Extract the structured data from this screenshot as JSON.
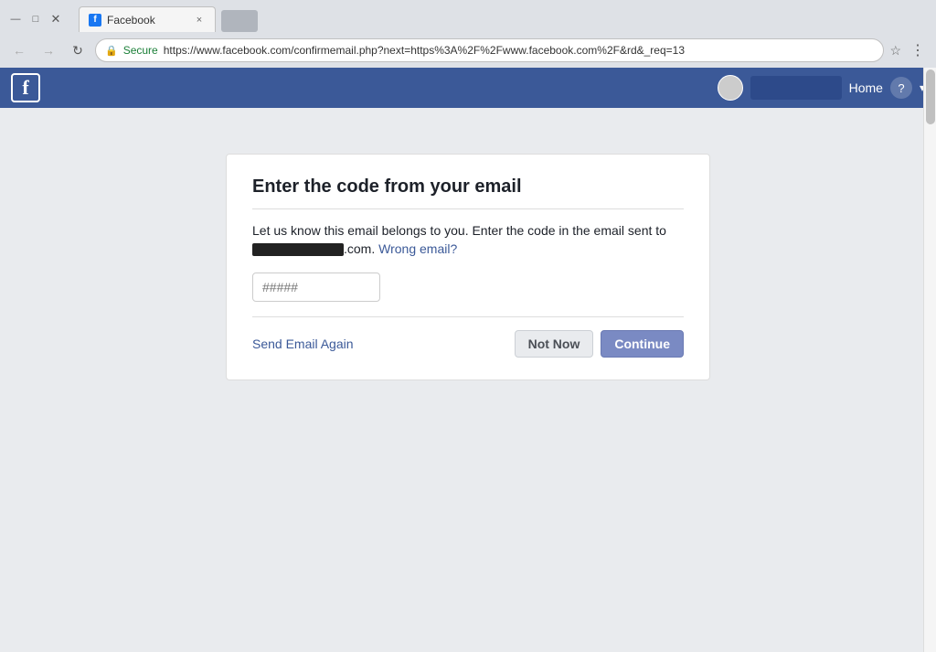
{
  "browser": {
    "title_bar": {
      "minimize_label": "—",
      "maximize_label": "□",
      "close_label": "✕"
    },
    "tab": {
      "favicon_letter": "f",
      "title": "Facebook",
      "close_label": "×"
    },
    "address_bar": {
      "secure_label": "Secure",
      "url": "https://www.facebook.com/confirmemail.php?next=https%3A%2F%2Fwww.facebook.com%2F&rd&_req=13",
      "lock_icon": "🔒",
      "star_icon": "☆"
    },
    "nav": {
      "back_icon": "←",
      "forward_icon": "→",
      "reload_icon": "↻",
      "menu_icon": "⋮"
    }
  },
  "facebook_header": {
    "logo_letter": "f",
    "home_label": "Home",
    "help_label": "?",
    "dropdown_icon": "▾"
  },
  "modal": {
    "title": "Enter the code from your email",
    "description_before": "Let us know this email belongs to you. Enter the code in the email sent to",
    "email_suffix": ".com.",
    "wrong_email_link": "Wrong email?",
    "code_placeholder": "#####",
    "send_again_label": "Send Email Again",
    "not_now_label": "Not Now",
    "continue_label": "Continue"
  }
}
